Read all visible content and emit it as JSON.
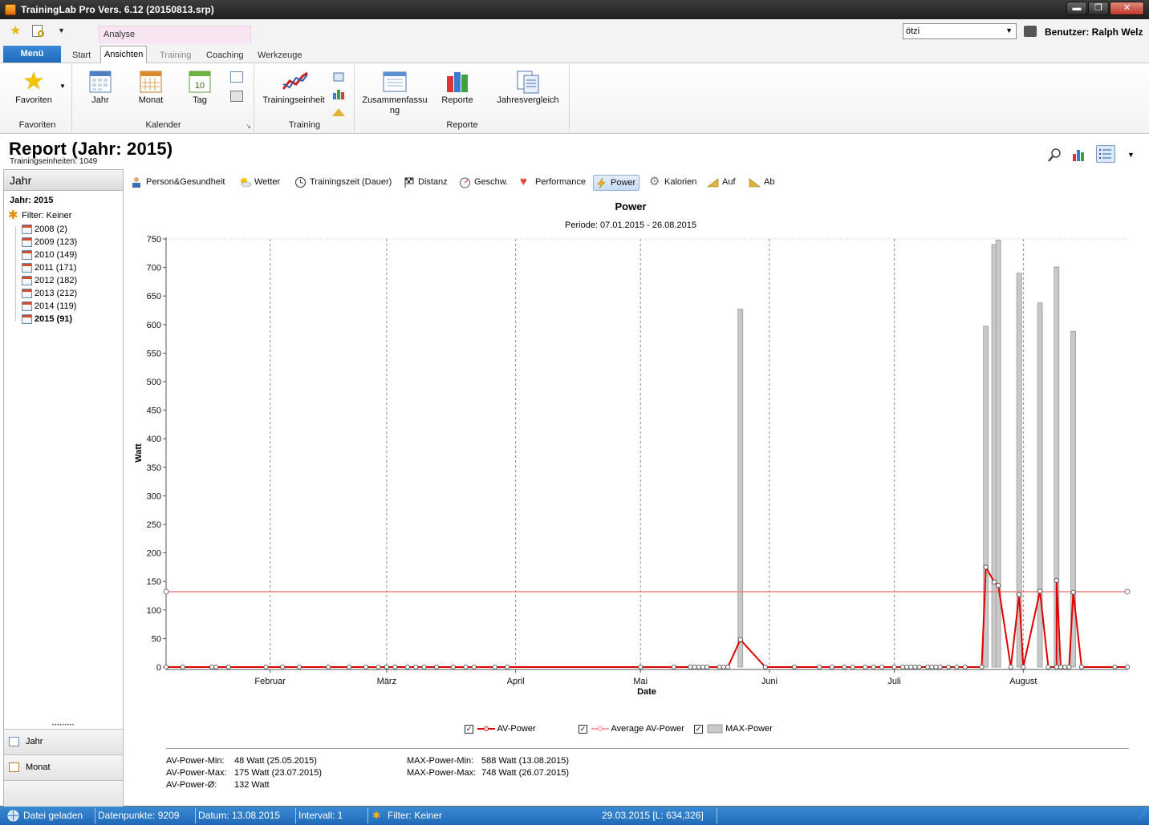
{
  "window": {
    "title": "TrainingLab Pro Vers. 6.12 (20150813.srp)",
    "minimize": "▬",
    "maximize": "❐",
    "close": "✕"
  },
  "ribbon": {
    "menu_label": "Menü",
    "contextual_group": "Analyse",
    "tabs": [
      "Start",
      "Ansichten",
      "Training",
      "Coaching",
      "Werkzeuge"
    ],
    "active_tab": "Ansichten",
    "user_select": {
      "value": "ötzi",
      "arrow": "▼"
    },
    "user_label": "Benutzer: Ralph Welz",
    "groups": {
      "favoriten": {
        "label": "Favoriten",
        "button": "Favoriten"
      },
      "kalender": {
        "label": "Kalender",
        "buttons": [
          "Jahr",
          "Monat",
          "Tag"
        ],
        "tag_day": "10"
      },
      "training": {
        "label": "Training",
        "button": "Trainingseinheit"
      },
      "reporte": {
        "label": "Reporte",
        "buttons": [
          "Zusammenfassu\nng",
          "Reporte",
          "Jahresvergleich"
        ]
      }
    }
  },
  "report": {
    "title": "Report (Jahr: 2015)",
    "subtitle": "Trainingseinheiten: 1049"
  },
  "left_panel": {
    "header": "Jahr",
    "year_label": "Jahr: 2015",
    "filter": "Filter: Keiner",
    "years": [
      "2008 (2)",
      "2009 (123)",
      "2010 (149)",
      "2011 (171)",
      "2012 (182)",
      "2013 (212)",
      "2014 (119)",
      "2015 (91)"
    ],
    "selected_year": "2015 (91)",
    "grip": "•••••••••",
    "nav": [
      "Jahr",
      "Monat"
    ]
  },
  "categories": [
    "Person&Gesundheit",
    "Wetter",
    "Trainingszeit (Dauer)",
    "Distanz",
    "Geschw.",
    "Performance",
    "Power",
    "Kalorien",
    "Auf",
    "Ab"
  ],
  "active_category": "Power",
  "chart_data": {
    "type": "line",
    "title": "Power",
    "subtitle": "Periode: 07.01.2015 - 26.08.2015",
    "xlabel": "Date",
    "ylabel": "Watt",
    "ylim": [
      0,
      750
    ],
    "y_ticks": [
      0,
      50,
      100,
      150,
      200,
      250,
      300,
      350,
      400,
      450,
      500,
      550,
      600,
      650,
      700,
      750
    ],
    "x_range": [
      "2015-01-07",
      "2015-08-26"
    ],
    "x_ticks": [
      {
        "label": "Februar",
        "date": "2015-02-01"
      },
      {
        "label": "März",
        "date": "2015-03-01"
      },
      {
        "label": "April",
        "date": "2015-04-01"
      },
      {
        "label": "Mai",
        "date": "2015-05-01"
      },
      {
        "label": "Juni",
        "date": "2015-06-01"
      },
      {
        "label": "Juli",
        "date": "2015-07-01"
      },
      {
        "label": "August",
        "date": "2015-08-01"
      }
    ],
    "grid": "vertical dashed",
    "legend_position": "bottom",
    "series": [
      {
        "name": "AV-Power",
        "type": "line",
        "color": "#e00000",
        "points": [
          [
            "2015-01-07",
            0
          ],
          [
            "2015-01-11",
            0
          ],
          [
            "2015-01-18",
            0
          ],
          [
            "2015-01-19",
            0
          ],
          [
            "2015-01-22",
            0
          ],
          [
            "2015-01-31",
            0
          ],
          [
            "2015-02-04",
            0
          ],
          [
            "2015-02-08",
            0
          ],
          [
            "2015-02-15",
            0
          ],
          [
            "2015-02-20",
            0
          ],
          [
            "2015-02-24",
            0
          ],
          [
            "2015-02-27",
            0
          ],
          [
            "2015-03-01",
            0
          ],
          [
            "2015-03-03",
            0
          ],
          [
            "2015-03-06",
            0
          ],
          [
            "2015-03-08",
            0
          ],
          [
            "2015-03-10",
            0
          ],
          [
            "2015-03-13",
            0
          ],
          [
            "2015-03-17",
            0
          ],
          [
            "2015-03-20",
            0
          ],
          [
            "2015-03-22",
            0
          ],
          [
            "2015-03-27",
            0
          ],
          [
            "2015-03-30",
            0
          ],
          [
            "2015-05-01",
            0
          ],
          [
            "2015-05-09",
            0
          ],
          [
            "2015-05-13",
            0
          ],
          [
            "2015-05-14",
            0
          ],
          [
            "2015-05-15",
            0
          ],
          [
            "2015-05-16",
            0
          ],
          [
            "2015-05-17",
            0
          ],
          [
            "2015-05-20",
            0
          ],
          [
            "2015-05-21",
            0
          ],
          [
            "2015-05-22",
            0
          ],
          [
            "2015-05-25",
            48
          ],
          [
            "2015-05-31",
            0
          ],
          [
            "2015-06-07",
            0
          ],
          [
            "2015-06-13",
            0
          ],
          [
            "2015-06-16",
            0
          ],
          [
            "2015-06-19",
            0
          ],
          [
            "2015-06-21",
            0
          ],
          [
            "2015-06-24",
            0
          ],
          [
            "2015-06-26",
            0
          ],
          [
            "2015-06-28",
            0
          ],
          [
            "2015-07-01",
            0
          ],
          [
            "2015-07-03",
            0
          ],
          [
            "2015-07-04",
            0
          ],
          [
            "2015-07-05",
            0
          ],
          [
            "2015-07-06",
            0
          ],
          [
            "2015-07-07",
            0
          ],
          [
            "2015-07-09",
            0
          ],
          [
            "2015-07-10",
            0
          ],
          [
            "2015-07-11",
            0
          ],
          [
            "2015-07-12",
            0
          ],
          [
            "2015-07-14",
            0
          ],
          [
            "2015-07-16",
            0
          ],
          [
            "2015-07-18",
            0
          ],
          [
            "2015-07-22",
            0
          ],
          [
            "2015-07-23",
            175
          ],
          [
            "2015-07-25",
            149
          ],
          [
            "2015-07-26",
            143
          ],
          [
            "2015-07-29",
            0
          ],
          [
            "2015-07-31",
            127
          ],
          [
            "2015-08-01",
            0
          ],
          [
            "2015-08-05",
            133
          ],
          [
            "2015-08-07",
            0
          ],
          [
            "2015-08-09",
            0
          ],
          [
            "2015-08-09",
            152
          ],
          [
            "2015-08-10",
            0
          ],
          [
            "2015-08-11",
            0
          ],
          [
            "2015-08-12",
            0
          ],
          [
            "2015-08-13",
            131
          ],
          [
            "2015-08-15",
            0
          ],
          [
            "2015-08-23",
            0
          ],
          [
            "2015-08-26",
            0
          ]
        ]
      },
      {
        "name": "Average AV-Power",
        "type": "line",
        "color": "#f08080",
        "points": [
          [
            "2015-01-07",
            132
          ],
          [
            "2015-08-26",
            132
          ]
        ]
      },
      {
        "name": "MAX-Power",
        "type": "bar",
        "color": "#c8c8c8",
        "points": [
          [
            "2015-05-25",
            627
          ],
          [
            "2015-07-23",
            597
          ],
          [
            "2015-07-25",
            740
          ],
          [
            "2015-07-26",
            748
          ],
          [
            "2015-07-31",
            690
          ],
          [
            "2015-08-05",
            638
          ],
          [
            "2015-08-09",
            701
          ],
          [
            "2015-08-13",
            588
          ]
        ]
      }
    ]
  },
  "legend": [
    {
      "label": "AV-Power",
      "checked": "✓"
    },
    {
      "label": "Average AV-Power",
      "checked": "✓"
    },
    {
      "label": "MAX-Power",
      "checked": "✓"
    }
  ],
  "stats": {
    "av_min_label": "AV-Power-Min:",
    "av_min_value": "48 Watt  (25.05.2015)",
    "av_max_label": "AV-Power-Max:",
    "av_max_value": "175 Watt  (23.07.2015)",
    "av_avg_label": "AV-Power-Ø:",
    "av_avg_value": "132 Watt",
    "max_min_label": "MAX-Power-Min:",
    "max_min_value": "588 Watt  (13.08.2015)",
    "max_max_label": "MAX-Power-Max:",
    "max_max_value": "748 Watt  (26.07.2015)"
  },
  "statusbar": {
    "loaded": "Datei geladen",
    "datapoints": "Datenpunkte: 9209",
    "date": "Datum: 13.08.2015",
    "interval": "Intervall: 1",
    "filter": "Filter: Keiner",
    "cursor": "29.03.2015 [L: 634,326]"
  },
  "colors": {
    "accent": "#1f6ab8",
    "av_power": "#e00000",
    "average": "#f08080",
    "max_power": "#c8c8c8"
  }
}
